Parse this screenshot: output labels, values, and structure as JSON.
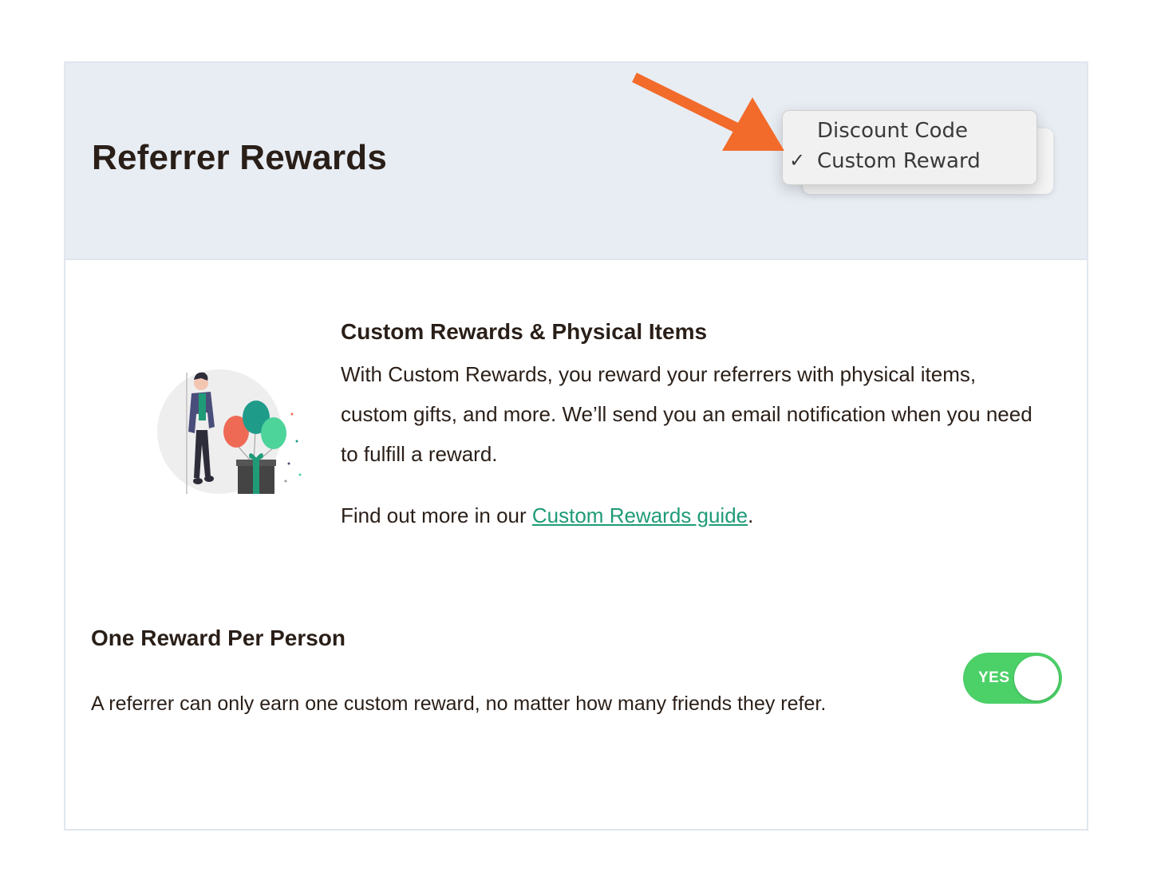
{
  "header": {
    "title": "Referrer Rewards"
  },
  "reward_type_dropdown": {
    "options": [
      {
        "label": "Discount Code",
        "selected": false
      },
      {
        "label": "Custom Reward",
        "selected": true
      }
    ],
    "check_mark": "✓"
  },
  "custom_rewards": {
    "title": "Custom Rewards & Physical Items",
    "description": "With Custom Rewards, you reward your referrers with physical items, custom gifts, and more. We’ll send you an email notification when you need to fulfill a reward.",
    "guide_prefix": "Find out more in our ",
    "guide_link": "Custom Rewards guide",
    "guide_suffix": "."
  },
  "one_reward_per_person": {
    "title": "One Reward Per Person",
    "description": "A referrer can only earn one custom reward, no matter how many friends they refer.",
    "toggle_label": "YES",
    "enabled": true
  },
  "colors": {
    "header_bg": "#e8edf4",
    "accent_link": "#1f9b78",
    "toggle_on": "#4cd068",
    "annotation_arrow": "#f26b2b",
    "text": "#2a1f18"
  },
  "icons": [
    "annotation-arrow-icon",
    "person-balloons-gift-illustration",
    "check-icon"
  ]
}
